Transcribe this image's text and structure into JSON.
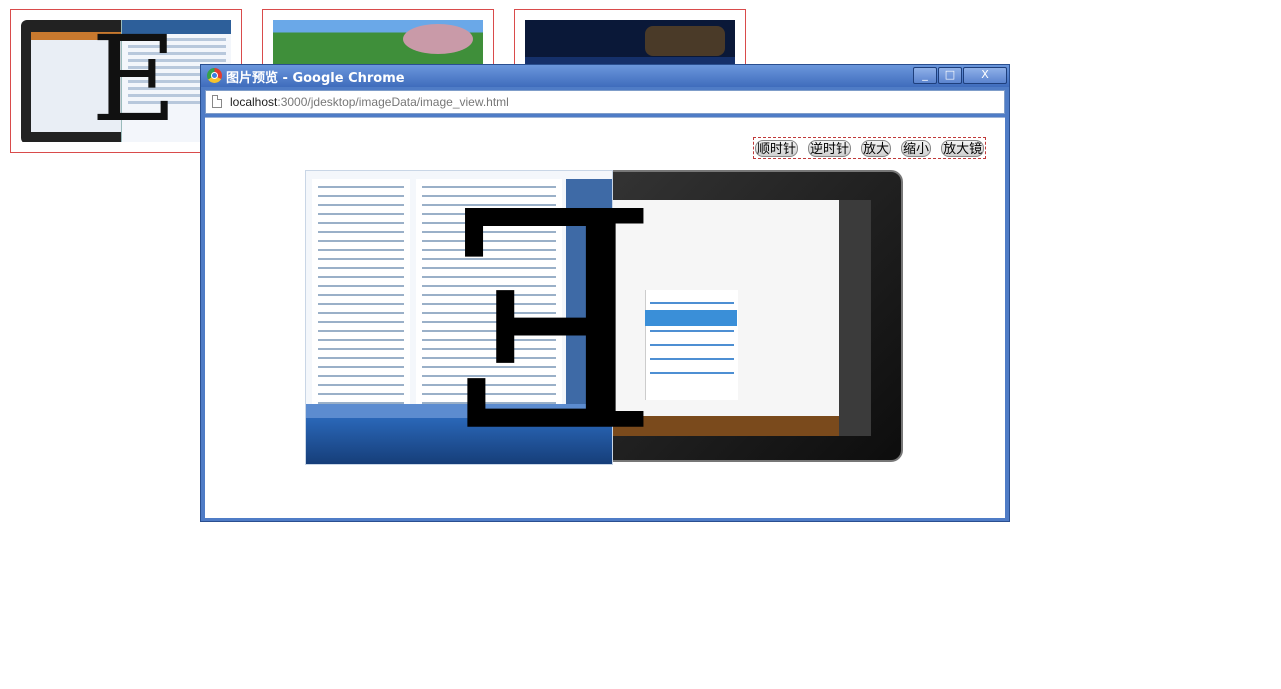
{
  "thumbnails": [
    {
      "name": "tablet-and-app-screenshot"
    },
    {
      "name": "flower-field"
    },
    {
      "name": "planet-space"
    }
  ],
  "popup": {
    "title": "图片预览  - Google Chrome",
    "buttons": {
      "minimize": "_",
      "maximize": "□",
      "close": "X"
    },
    "url_host": "localhost",
    "url_rest": ":3000/jdesktop/imageData/image_view.html"
  },
  "toolbar": {
    "rotate_cw": "顺时针",
    "rotate_ccw": "逆时针",
    "zoom_in": "放大",
    "zoom_out": "缩小",
    "magnifier": "放大镜"
  },
  "preview": {
    "big_letter": "E"
  },
  "colors": {
    "thumb_border": "#d94b4b",
    "titlebar": "#4f7cc6",
    "toolbar_border": "#c03a3a"
  }
}
